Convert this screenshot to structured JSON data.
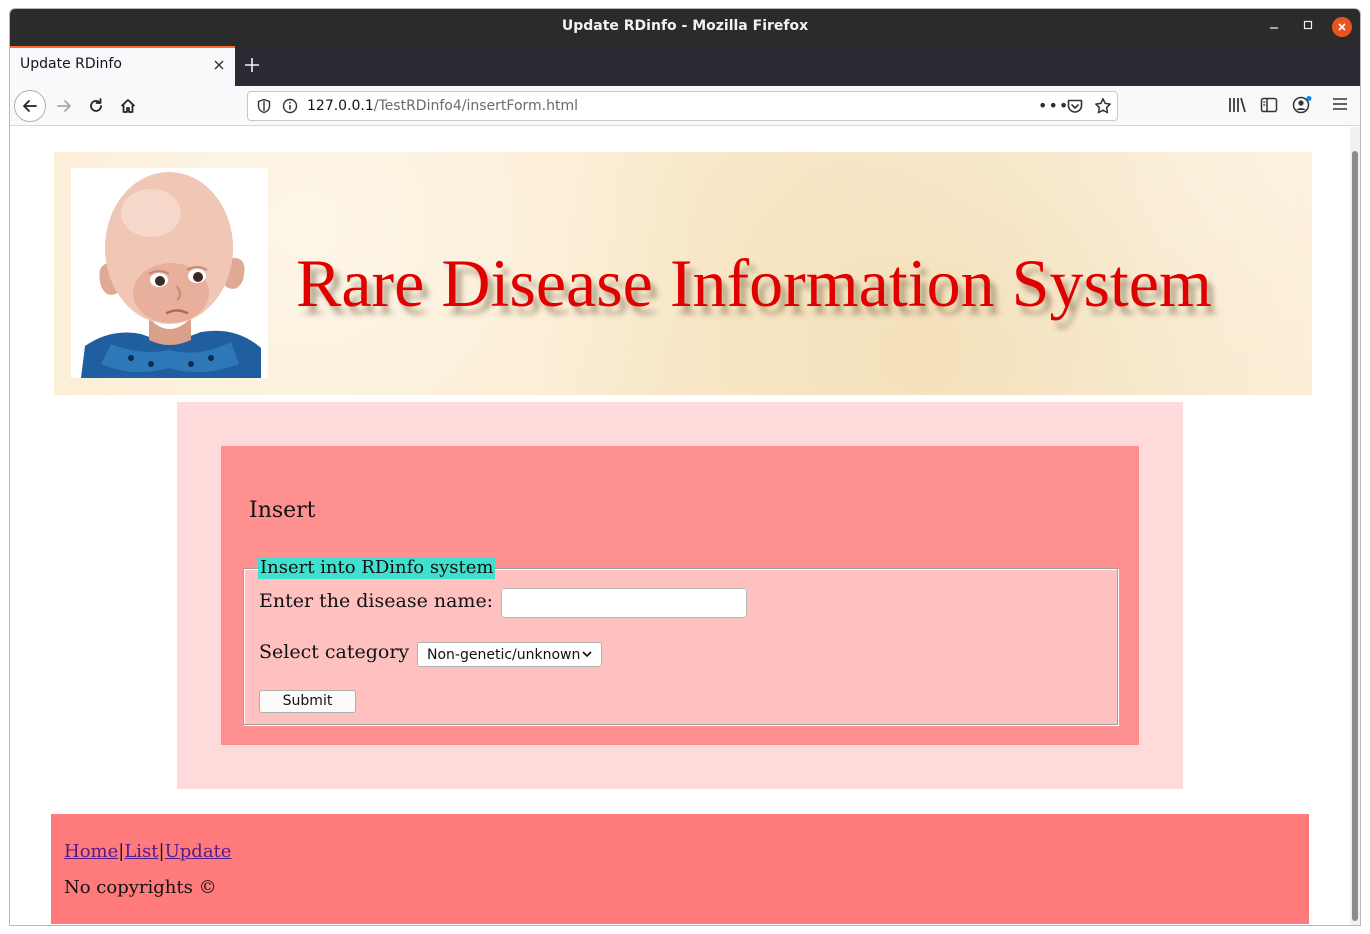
{
  "window": {
    "title": "Update RDinfo - Mozilla Firefox",
    "min_icon": "minimize-icon",
    "max_icon": "maximize-icon",
    "close_icon": "close-icon"
  },
  "tabs": [
    {
      "label": "Update RDinfo",
      "active": true
    }
  ],
  "navbar": {
    "url_host": "127.0.0.1",
    "url_path": "/TestRDinfo4/insertForm.html",
    "more_label": "•••"
  },
  "page": {
    "site_title": "Rare Disease Information System",
    "form": {
      "heading": "Insert",
      "legend": "Insert into RDinfo system",
      "name_label": "Enter the disease name:",
      "name_value": "",
      "category_label": "Select category",
      "category_selected": "Non-genetic/unknown",
      "submit_label": "Submit"
    },
    "footer": {
      "links": [
        "Home",
        "List",
        "Update"
      ],
      "separator": "|",
      "copyright": "No copyrights ©"
    }
  },
  "colors": {
    "title_red": "#e00000",
    "outer_panel": "#ffdada",
    "inner_panel": "#ff9090",
    "fieldset": "#ffc0c0",
    "legend_bg": "#40e0d0",
    "footer_bg": "#ff7b7b",
    "link": "#551a8b",
    "firefox_close": "#e95420"
  }
}
